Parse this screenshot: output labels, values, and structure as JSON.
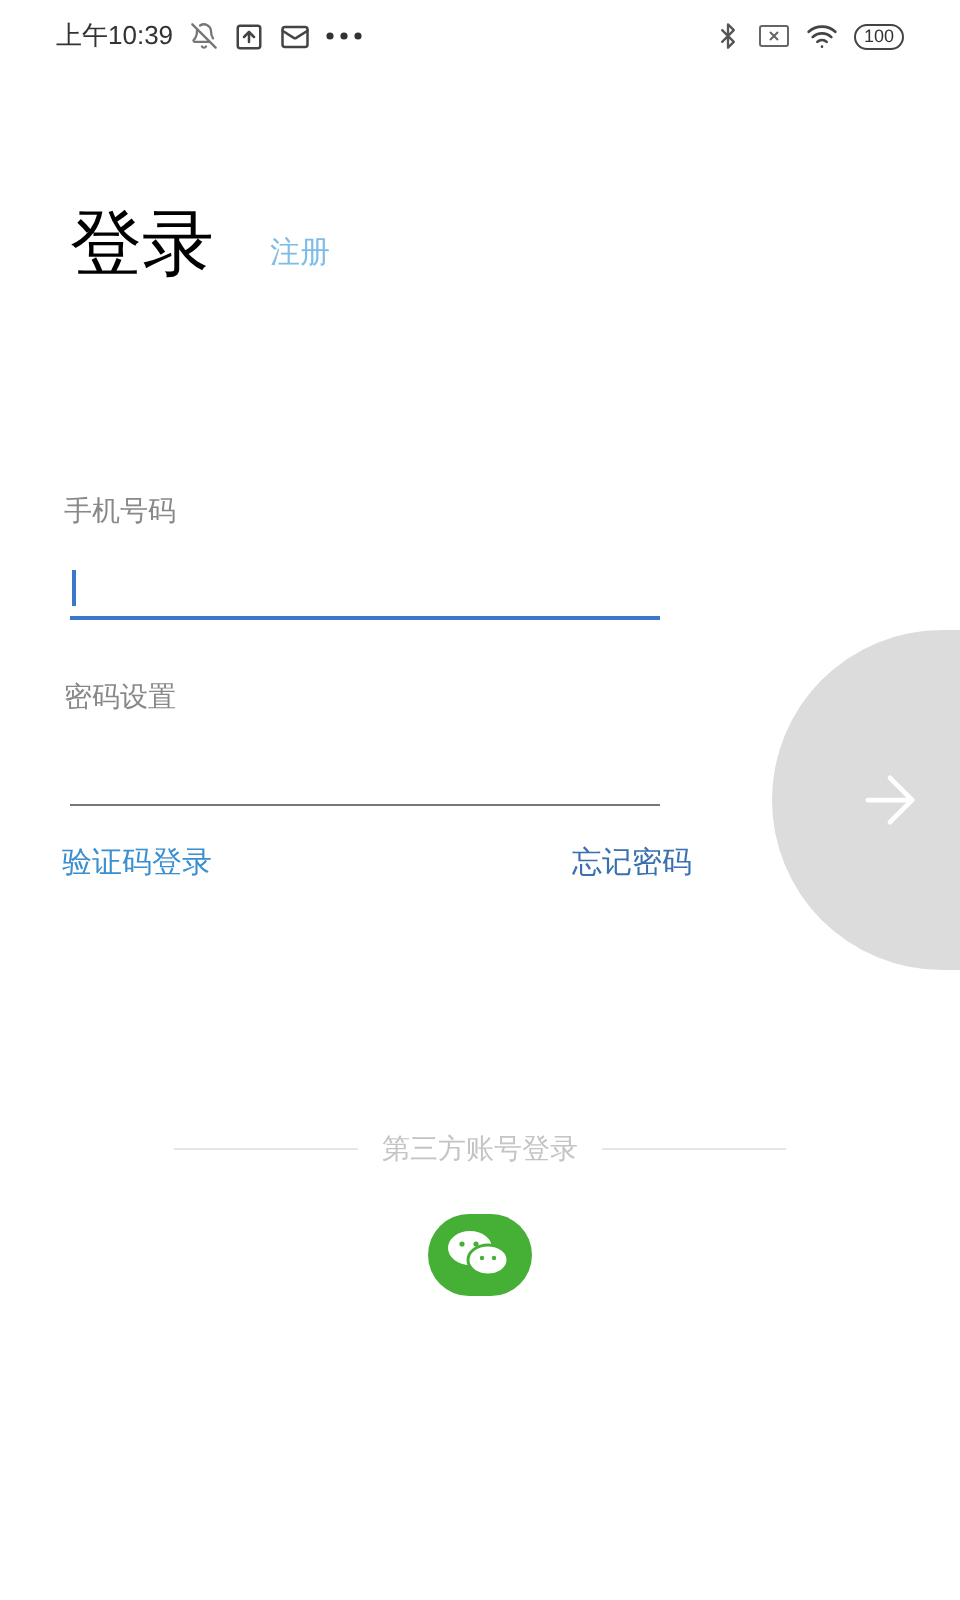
{
  "status_bar": {
    "time": "上午10:39",
    "battery": "100"
  },
  "header": {
    "title": "登录",
    "register_link": "注册"
  },
  "fields": [
    {
      "label": "手机号码",
      "focused": true
    },
    {
      "label": "密码设置",
      "focused": false
    }
  ],
  "links": {
    "sms_login": "验证码登录",
    "forgot_password": "忘记密码"
  },
  "third_party": {
    "divider_text": "第三方账号登录"
  }
}
